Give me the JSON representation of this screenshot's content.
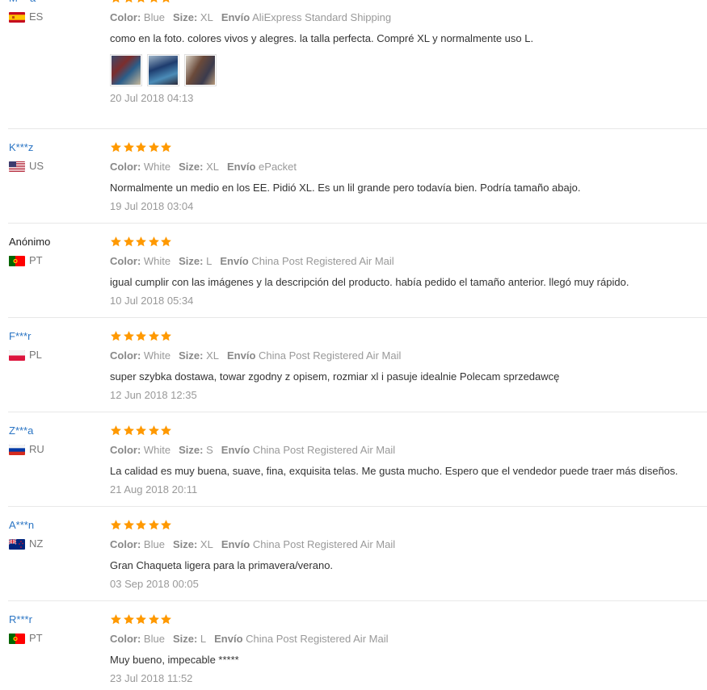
{
  "labels": {
    "color": "Color:",
    "size": "Size:",
    "shipping": "Envío"
  },
  "colors": {
    "star": "#ff9900",
    "username": "#2b75c4"
  },
  "reviews": [
    {
      "user": "M***a",
      "country": "ES",
      "flag": "spain-flag-icon",
      "rating": 5,
      "color": "Blue",
      "size": "XL",
      "shipping": "AliExpress Standard Shipping",
      "text": "como en la foto. colores vivos y alegres. la talla perfecta. Compré XL y normalmente uso L.",
      "date": "20 Jul 2018 04:13",
      "photos": 3
    },
    {
      "user": "K***z",
      "country": "US",
      "flag": "usa-flag-icon",
      "rating": 5,
      "color": "White",
      "size": "XL",
      "shipping": "ePacket",
      "text": "Normalmente un medio en los EE. Pidió XL. Es un lil grande pero todavía bien. Podría tamaño abajo.",
      "date": "19 Jul 2018 03:04"
    },
    {
      "user": "Anónimo",
      "country": "PT",
      "flag": "portugal-flag-icon",
      "rating": 5,
      "color": "White",
      "size": "L",
      "shipping": "China Post Registered Air Mail",
      "text": "igual cumplir con las imágenes y la descripción del producto. había pedido el tamaño anterior. llegó muy rápido.",
      "date": "10 Jul 2018 05:34"
    },
    {
      "user": "F***r",
      "country": "PL",
      "flag": "poland-flag-icon",
      "rating": 5,
      "color": "White",
      "size": "XL",
      "shipping": "China Post Registered Air Mail",
      "text": "super szybka dostawa, towar zgodny z opisem, rozmiar xl i pasuje idealnie Polecam sprzedawcę",
      "date": "12 Jun 2018 12:35"
    },
    {
      "user": "Z***a",
      "country": "RU",
      "flag": "russia-flag-icon",
      "rating": 5,
      "color": "White",
      "size": "S",
      "shipping": "China Post Registered Air Mail",
      "text": "La calidad es muy buena, suave, fina, exquisita telas. Me gusta mucho. Espero que el vendedor puede traer más diseños.",
      "date": "21 Aug 2018 20:11"
    },
    {
      "user": "A***n",
      "country": "NZ",
      "flag": "new-zealand-flag-icon",
      "rating": 5,
      "color": "Blue",
      "size": "XL",
      "shipping": "China Post Registered Air Mail",
      "text": "Gran Chaqueta ligera para la primavera/verano.",
      "date": "03 Sep 2018 00:05"
    },
    {
      "user": "R***r",
      "country": "PT",
      "flag": "portugal-flag-icon",
      "rating": 5,
      "color": "Blue",
      "size": "L",
      "shipping": "China Post Registered Air Mail",
      "text": "Muy bueno, impecable *****",
      "date": "23 Jul 2018 11:52"
    }
  ]
}
